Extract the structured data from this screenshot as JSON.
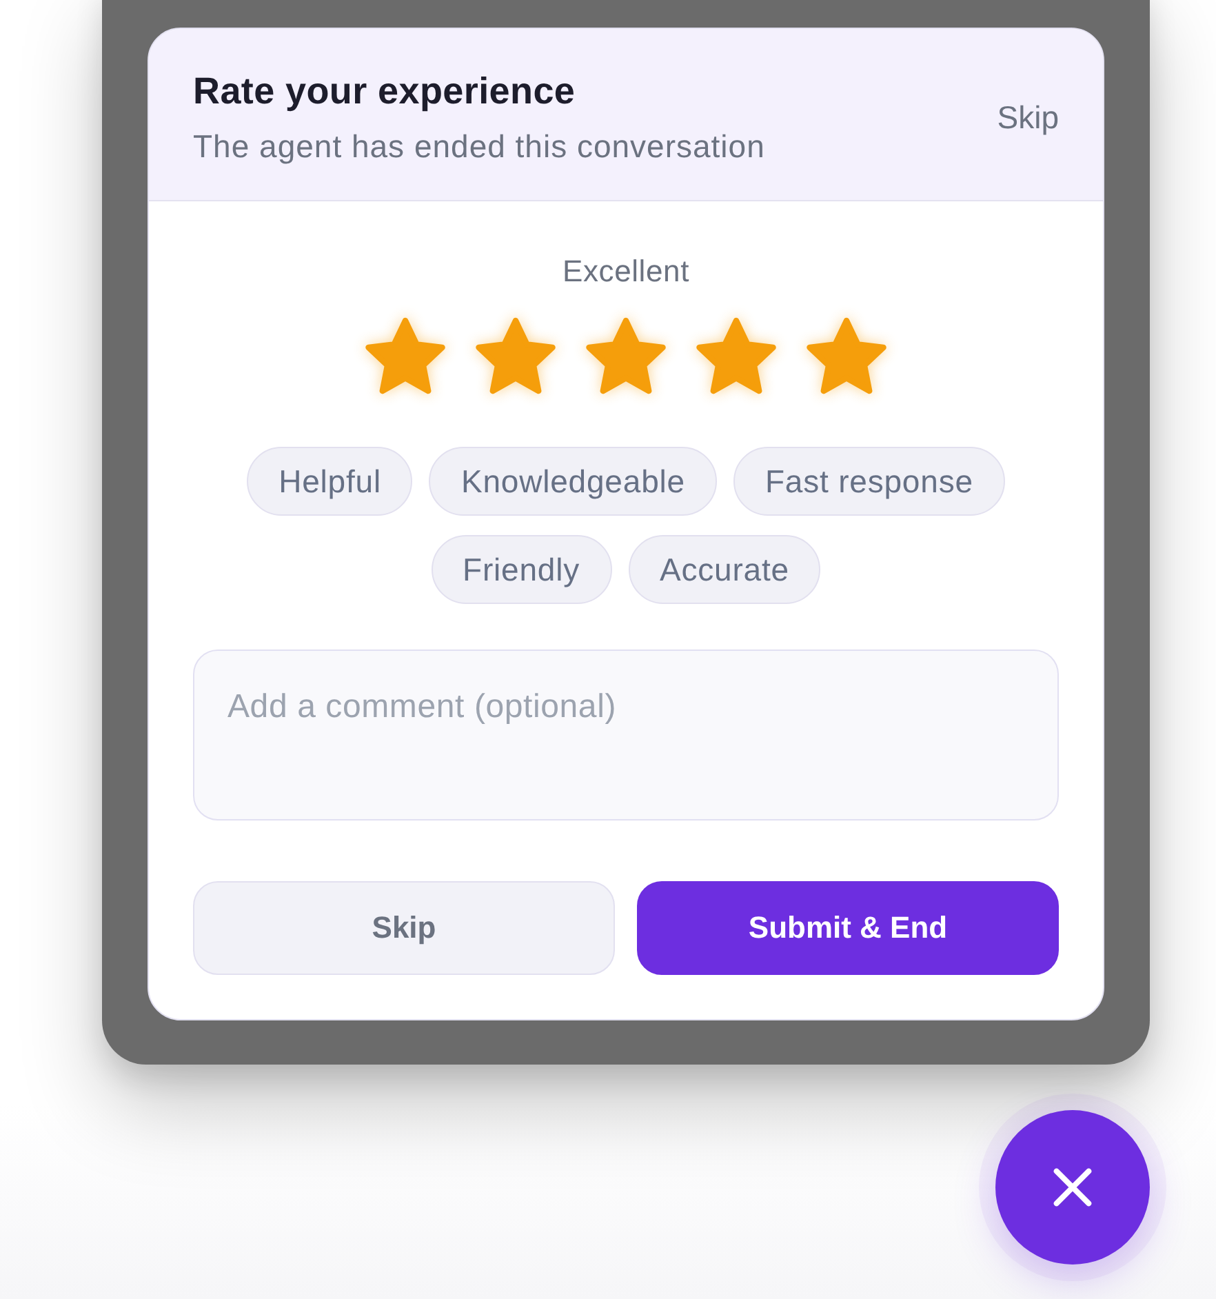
{
  "header": {
    "title": "Rate your experience",
    "subtitle": "The agent has ended this conversation",
    "skip_label": "Skip"
  },
  "rating": {
    "label": "Excellent",
    "stars": 5
  },
  "tags": [
    {
      "label": "Helpful",
      "selected": false
    },
    {
      "label": "Knowledgeable",
      "selected": false
    },
    {
      "label": "Fast response",
      "selected": false
    },
    {
      "label": "Friendly",
      "selected": false
    },
    {
      "label": "Accurate",
      "selected": false
    }
  ],
  "comment": {
    "placeholder": "Add a comment (optional)"
  },
  "buttons": [
    {
      "label": "Skip",
      "kind": "secondary"
    },
    {
      "label": "Submit & End",
      "kind": "primary"
    }
  ]
}
